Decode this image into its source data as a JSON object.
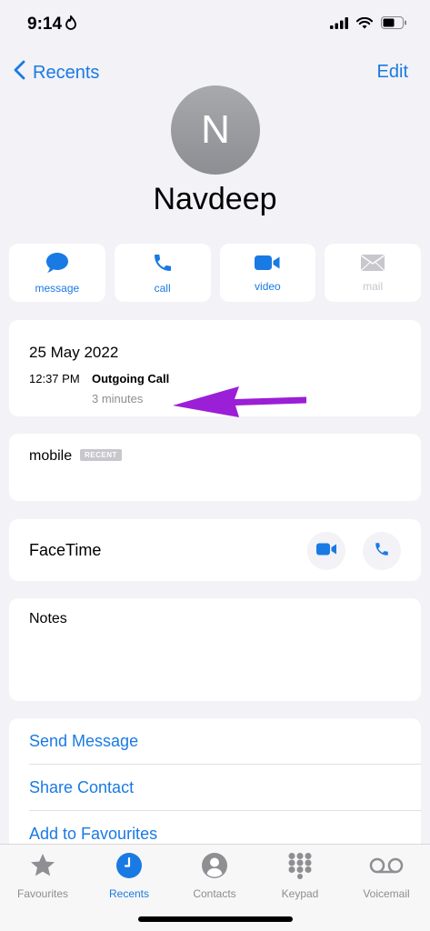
{
  "status_bar": {
    "time": "9:14"
  },
  "nav": {
    "back_label": "Recents",
    "edit_label": "Edit"
  },
  "contact": {
    "initial": "N",
    "name": "Navdeep"
  },
  "actions": [
    {
      "label": "message",
      "icon": "message-bubble-icon",
      "enabled": true
    },
    {
      "label": "call",
      "icon": "phone-icon",
      "enabled": true
    },
    {
      "label": "video",
      "icon": "video-camera-icon",
      "enabled": true
    },
    {
      "label": "mail",
      "icon": "envelope-icon",
      "enabled": false
    }
  ],
  "call_log": {
    "date": "25 May 2022",
    "time": "12:37 PM",
    "call_type": "Outgoing Call",
    "duration": "3 minutes"
  },
  "mobile": {
    "label": "mobile",
    "badge": "RECENT"
  },
  "facetime": {
    "label": "FaceTime"
  },
  "notes": {
    "label": "Notes"
  },
  "list_actions": [
    "Send Message",
    "Share Contact",
    "Add to Favourites"
  ],
  "tabs": [
    {
      "label": "Favourites",
      "icon": "star-icon",
      "active": false
    },
    {
      "label": "Recents",
      "icon": "clock-icon",
      "active": true
    },
    {
      "label": "Contacts",
      "icon": "person-icon",
      "active": false
    },
    {
      "label": "Keypad",
      "icon": "keypad-icon",
      "active": false
    },
    {
      "label": "Voicemail",
      "icon": "voicemail-icon",
      "active": false
    }
  ],
  "colors": {
    "accent": "#1a7ae3",
    "annotation_arrow": "#9b1fd6",
    "background": "#f2f2f7"
  }
}
